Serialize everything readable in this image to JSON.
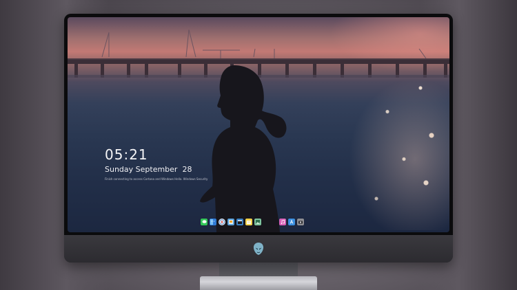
{
  "lockscreen": {
    "time": "05:21",
    "date": "Sunday September  28",
    "notice": "Finish connecting to access Cortana and Windows Hello. Windows Security"
  },
  "dock": {
    "icons": [
      {
        "name": "messages-icon",
        "color": "#34c759"
      },
      {
        "name": "finder-icon",
        "color": "#2f7bd6"
      },
      {
        "name": "safari-icon",
        "color": "#e8e8ea"
      },
      {
        "name": "preview-icon",
        "color": "#5aa0d8"
      },
      {
        "name": "clapper-icon",
        "color": "#3a80c2"
      },
      {
        "name": "notes-icon",
        "color": "#f5d24a"
      },
      {
        "name": "photos-icon",
        "color": "#7fc4a0"
      },
      {
        "name": "itunes-icon",
        "color": "#d65fb6"
      },
      {
        "name": "app-store-icon",
        "color": "#3a8fe0"
      },
      {
        "name": "camera-icon",
        "color": "#8e8e93"
      }
    ]
  },
  "colors": {
    "sky_top": "#5b4a5e",
    "sky_pink": "#c27974",
    "water": "#2a3852",
    "bezel": "#0b0b0d",
    "chin": "#3a393e"
  }
}
